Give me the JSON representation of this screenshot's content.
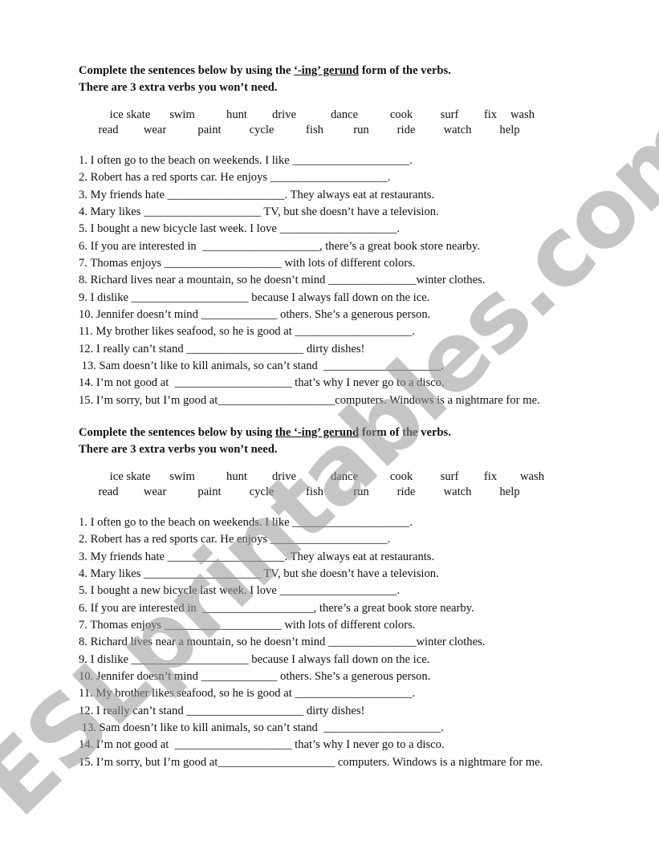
{
  "worksheet": {
    "watermark": "ESLprintables.com",
    "sections": [
      {
        "heading": {
          "line1_pre": "Complete the sentences below by using the ",
          "line1_underlined": "‘-ing’ gerund",
          "line1_post": " form of the verbs.",
          "line2": "There are 3 extra verbs you won’t need."
        },
        "verb_bank": {
          "row1": [
            "ice skate",
            "swim",
            "hunt",
            "drive",
            "dance",
            "cook",
            "surf",
            "fix",
            "wash"
          ],
          "row2": [
            "read",
            "wear",
            "paint",
            "cycle",
            "fish",
            "run",
            "ride",
            "watch",
            "help"
          ]
        },
        "sentences": [
          "1. I often go to the beach on weekends. I like ____________________.",
          "2. Robert has a red sports car. He enjoys ____________________.",
          "3. My friends hate ____________________. They always eat at restaurants.",
          "4. Mary likes ____________________ TV, but she doesn’t have a television.",
          "5. I bought a new bicycle last week. I love ____________________.",
          "6. If you are interested in  ____________________, there’s a great book store nearby.",
          "7. Thomas enjoys ____________________ with lots of different colors.",
          "8. Richard lives near a mountain, so he doesn’t mind _______________winter clothes.",
          "9. I dislike ____________________ because I always fall down on the ice.",
          "10. Jennifer doesn’t mind _____________ others. She’s a generous person.",
          "11. My brother likes seafood, so he is good at ____________________.",
          "12. I really can’t stand ____________________ dirty dishes!",
          " 13. Sam doesn’t like to kill animals, so can’t stand  ____________________.",
          "14. I’m not good at  ____________________ that’s why I never go to a disco.",
          "15. I’m sorry, but I’m good at____________________computers. Windows is a nightmare for me."
        ]
      },
      {
        "heading": {
          "line1_pre": "Complete the sentences below by using ",
          "line1_underlined": "the ‘-ing’ gerund",
          "line1_post": " form of the verbs.",
          "line2": "There are 3 extra verbs you won’t need."
        },
        "verb_bank": {
          "row1": [
            "ice skate",
            "swim",
            "hunt",
            "drive",
            "dance",
            "cook",
            "surf",
            "fix",
            "wash"
          ],
          "row2": [
            "read",
            "wear",
            "paint",
            "cycle",
            "fish",
            "run",
            "ride",
            "watch",
            "help"
          ]
        },
        "sentences": [
          "1. I often go to the beach on weekends. I like ____________________.",
          "2. Robert has a red sports car. He enjoys ____________________.",
          "3. My friends hate ____________________. They always eat at restaurants.",
          "4. Mary likes ____________________ TV, but she doesn’t have a television.",
          "5. I bought a new bicycle last week. I love ____________________.",
          "6. If you are interested in  ___________________, there’s a great book store nearby.",
          "7. Thomas enjoys ____________________ with lots of different colors.",
          "8. Richard lives near a mountain, so he doesn’t mind _______________winter clothes.",
          "9. I dislike ____________________ because I always fall down on the ice.",
          "10. Jennifer doesn’t mind _____________ others. She’s a generous person.",
          "11. My brother likes seafood, so he is good at ____________________.",
          "12. I really can’t stand ____________________ dirty dishes!",
          " 13. Sam doesn’t like to kill animals, so can’t stand  ____________________.",
          "14. I’m not good at  ____________________ that’s why I never go to a disco.",
          "15. I’m sorry, but I’m good at____________________ computers. Windows is a nightmare for me."
        ]
      }
    ]
  }
}
